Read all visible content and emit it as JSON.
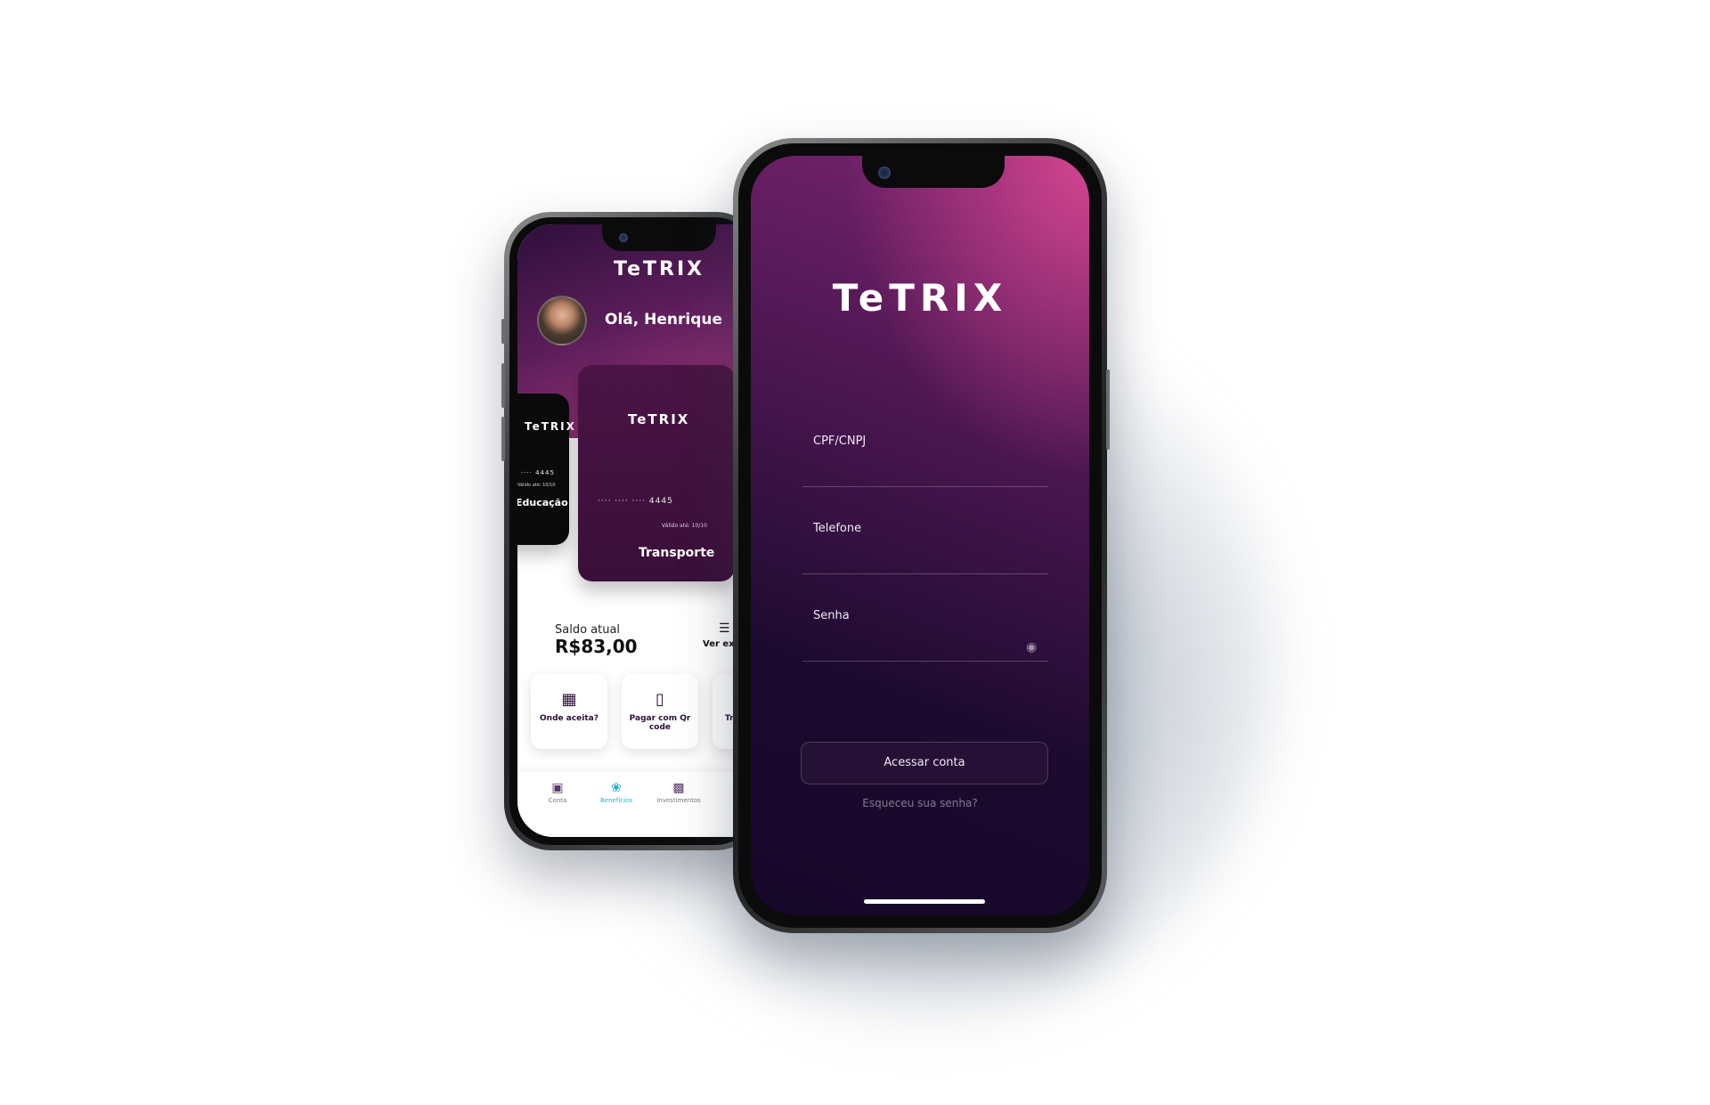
{
  "back_screen": {
    "logo": "TeTRIX",
    "greeting": "Olá, Henrique",
    "cards": [
      {
        "logo": "TeTRIX",
        "digits": "····  4445",
        "valid": "Válido até: 10/10",
        "name": "Educação",
        "color": "#0a0a0a"
      },
      {
        "logo": "TeTRIX",
        "digits": "····  ····  ····  4445",
        "valid": "Válido até: 10/10",
        "name": "Transporte",
        "color": "#3a0f3a"
      }
    ],
    "balance": {
      "label": "Saldo atual",
      "value": "R$83,00"
    },
    "statement_label": "Ver extrato",
    "actions": [
      {
        "label": "Onde aceita?",
        "icon": "store-icon"
      },
      {
        "label": "Pagar com Qr code",
        "icon": "phone-icon"
      },
      {
        "label": "Tr",
        "icon": "transfer-icon"
      }
    ],
    "tabs": [
      {
        "label": "Conta",
        "icon": "wallet-icon"
      },
      {
        "label": "Benefícios",
        "icon": "hand-coin-icon",
        "active": true
      },
      {
        "label": "Investimentos",
        "icon": "chart-icon"
      }
    ],
    "active_tab_color": "#1fb3c8"
  },
  "front_screen": {
    "logo": "TeTRIX",
    "fields": [
      {
        "label": "CPF/CNPJ",
        "value": ""
      },
      {
        "label": "Telefone",
        "value": ""
      },
      {
        "label": "Senha",
        "value": ""
      }
    ],
    "login_button": "Acessar conta",
    "forgot_link": "Esqueceu sua senha?"
  },
  "colors": {
    "brand_pink": "#d4458f",
    "brand_purple_dark": "#16082a",
    "brand_plum": "#4a1444"
  }
}
